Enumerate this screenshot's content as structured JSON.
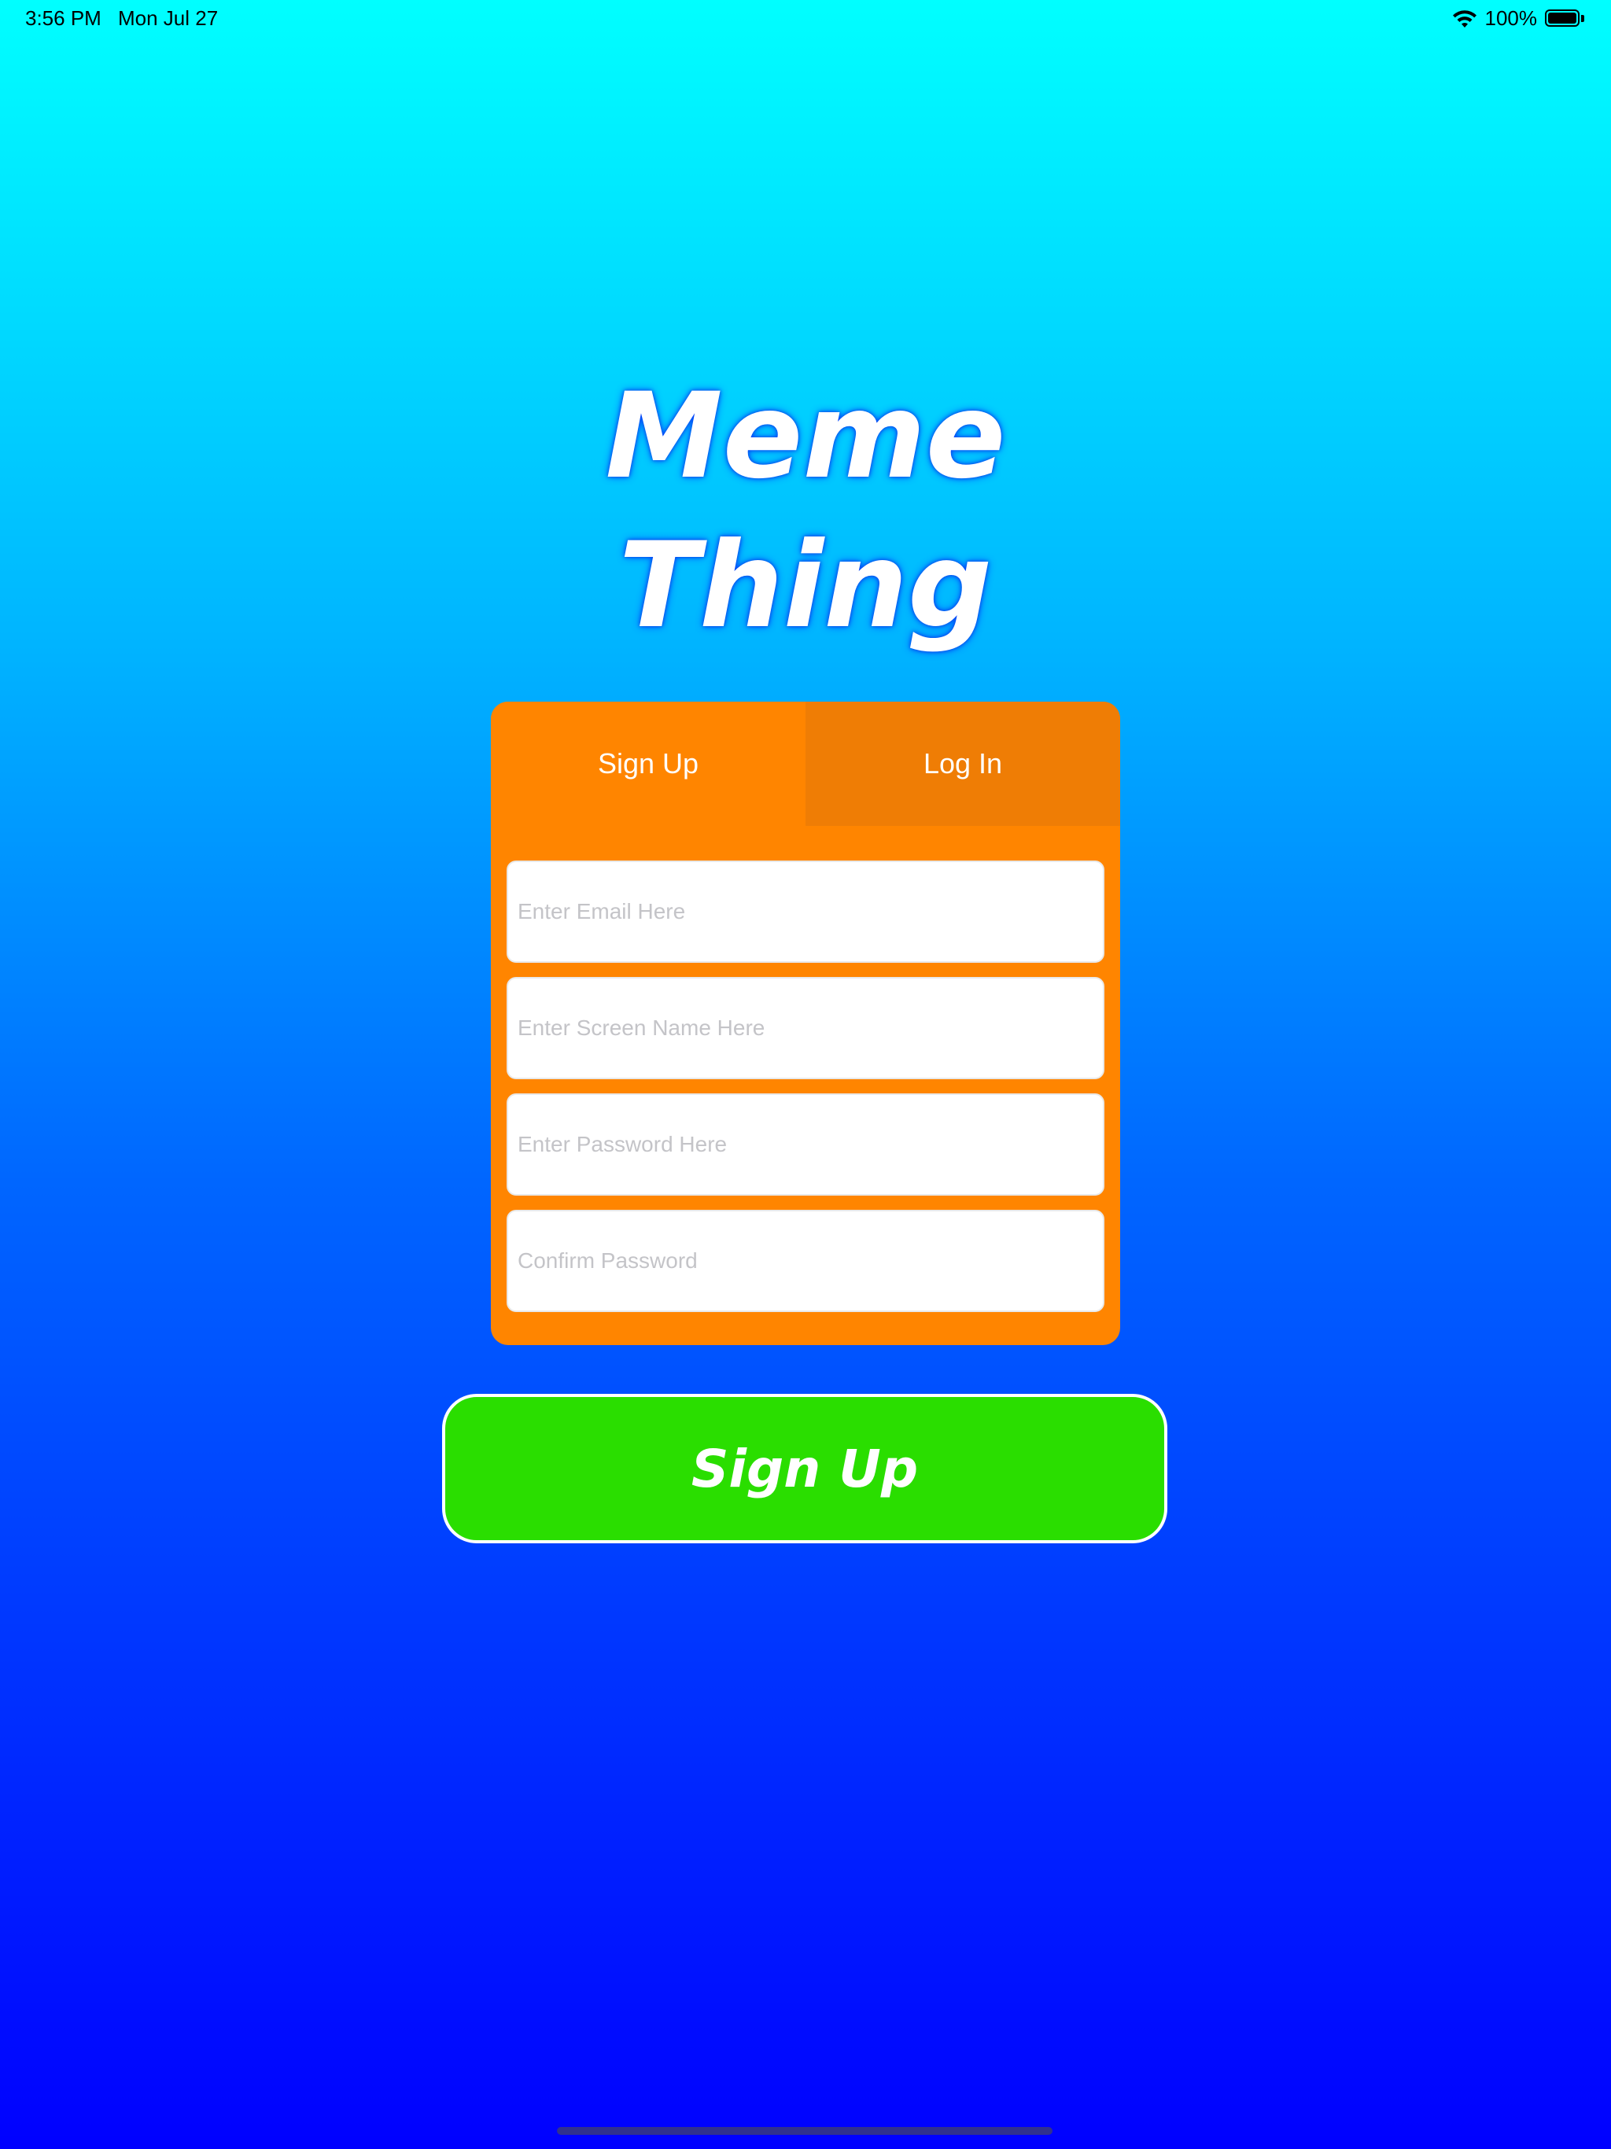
{
  "status_bar": {
    "time": "3:56 PM",
    "date": "Mon Jul 27",
    "battery_text": "100%",
    "battery_level": 1.0,
    "icons": [
      "wifi-icon",
      "battery-icon"
    ]
  },
  "title": {
    "line1": "Meme",
    "line2": "Thing"
  },
  "tabs": {
    "active": "signup",
    "signup_label": "Sign Up",
    "login_label": "Log In"
  },
  "fields": {
    "email_placeholder": "Enter Email Here",
    "email_value": "",
    "screen_name_placeholder": "Enter Screen Name Here",
    "screen_name_value": "",
    "password_placeholder": "Enter Password Here",
    "password_value": "",
    "confirm_password_placeholder": "Confirm Password",
    "confirm_password_value": ""
  },
  "submit": {
    "label": "Sign Up"
  },
  "colors": {
    "background_top": "#00ffff",
    "background_bottom": "#0000ff",
    "card": "#ff8500",
    "tab_inactive": "#ef7d05",
    "submit_button": "#2ade00",
    "text_light": "#ffffff"
  }
}
